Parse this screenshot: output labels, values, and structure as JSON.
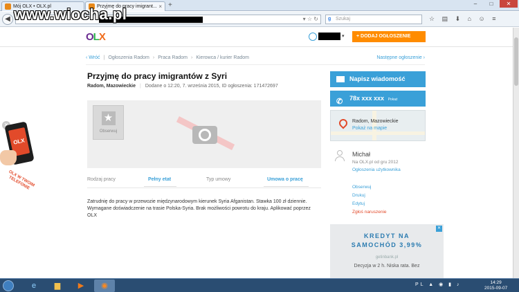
{
  "browser": {
    "tabs": [
      {
        "label": "Mój OLX • OLX.pl"
      },
      {
        "label": "Przyjmę do pracy imigrant..."
      }
    ],
    "new_tab": "+",
    "search_placeholder": "Szukaj",
    "window_controls": [
      "–",
      "□",
      "✕"
    ],
    "back_arrow": "◀"
  },
  "watermark": "www.wiocha.pl",
  "olx": {
    "logo": {
      "o": "O",
      "l": "L",
      "x": "X"
    },
    "add_button": "+ DODAJ OGŁOSZENIE",
    "user_caret": "▾",
    "breadcrumb": {
      "back": "‹ Wróć",
      "items": [
        "Ogłoszenia Radom",
        "Praca Radom",
        "Kierowca / kurier Radom"
      ],
      "next": "Następne ogłoszenie ›"
    },
    "ad": {
      "title": "Przyjmę do pracy imigrantów z Syri",
      "location": "Radom, Mazowieckie",
      "meta": "Dodane o 12:20, 7. września 2015, ID ogłoszenia: 171472697",
      "observe": "Obserwuj",
      "params": [
        {
          "key": "Rodzaj pracy",
          "value": "Pełny etat"
        },
        {
          "key": "Typ umowy",
          "value": "Umowa o pracę"
        }
      ],
      "description": "Zatrudnię do pracy w przewozie międzynarodowym kierunek Syria Afganistan. Stawka 100 zł dziennie. Wymagane doświadczenie na trasie Polska-Syria. Brak możliwości powrotu do kraju. Aplikować poprzez OLX"
    },
    "sidebar": {
      "message_button": "Napisz wiadomość",
      "phone_number": "78x xxx xxx",
      "phone_show": "Pokaż",
      "map_location": "Radom, Mazowieckie",
      "map_link": "Pokaż na mapie",
      "seller_name": "Michał",
      "seller_since": "Na OLX.pl od gru 2012",
      "seller_more": "Ogłoszenia użytkownika",
      "links": [
        "Obserwuj",
        "Drukuj",
        "Edytuj"
      ],
      "report": "Zgłoś naruszenie"
    },
    "banner": {
      "line1": "KREDYT NA",
      "line2": "SAMOCHÓD 3,99%",
      "brand": "getinbank.pl",
      "line3": "Decyzja w 2 h. Niska rata. Bez"
    },
    "promo": {
      "screen": "OLX",
      "text": "OLX W TWOIM TELEFONIE"
    }
  },
  "taskbar": {
    "tray": "PL ▲ ◉ ▮ ♪",
    "time": "14:29",
    "date": "2015-09-07"
  }
}
